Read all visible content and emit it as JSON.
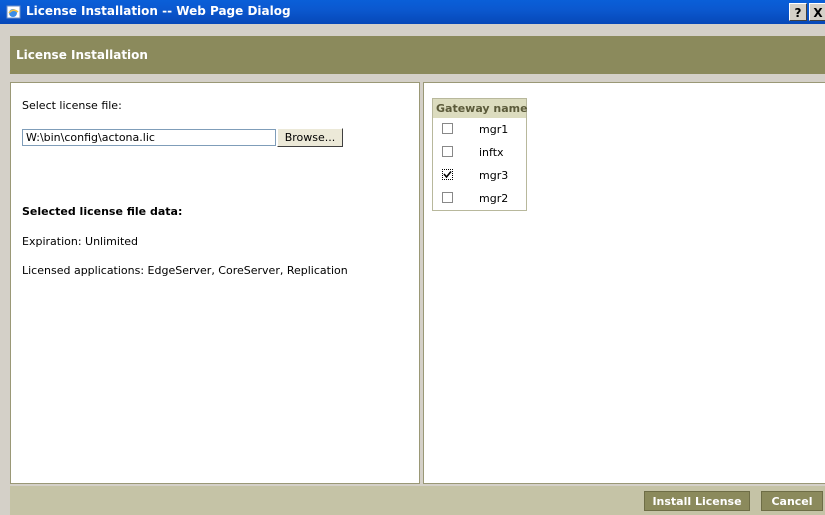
{
  "window": {
    "title": "License Installation -- Web Page Dialog",
    "help_label": "?",
    "close_label": "X",
    "app_icon": "ie-page-icon"
  },
  "header": {
    "title": "License Installation"
  },
  "left": {
    "select_label": "Select license file:",
    "file_value": "W:\\bin\\config\\actona.lic",
    "browse_label": "Browse...",
    "selected_data_heading": "Selected license file data:",
    "expiration": "Expiration: Unlimited",
    "licensed_apps": "Licensed applications: EdgeServer, CoreServer, Replication"
  },
  "gateways": {
    "header": "Gateway name",
    "items": [
      {
        "name": "mgr1",
        "checked": false
      },
      {
        "name": "inftx",
        "checked": false
      },
      {
        "name": "mgr3",
        "checked": true
      },
      {
        "name": "mgr2",
        "checked": false
      }
    ]
  },
  "footer": {
    "install_label": "Install License",
    "cancel_label": "Cancel"
  },
  "colors": {
    "title_bar": "#0a5fd8",
    "header_band": "#8b8a5c",
    "footer": "#c5c3a6",
    "table_header": "#dcdcbf"
  }
}
